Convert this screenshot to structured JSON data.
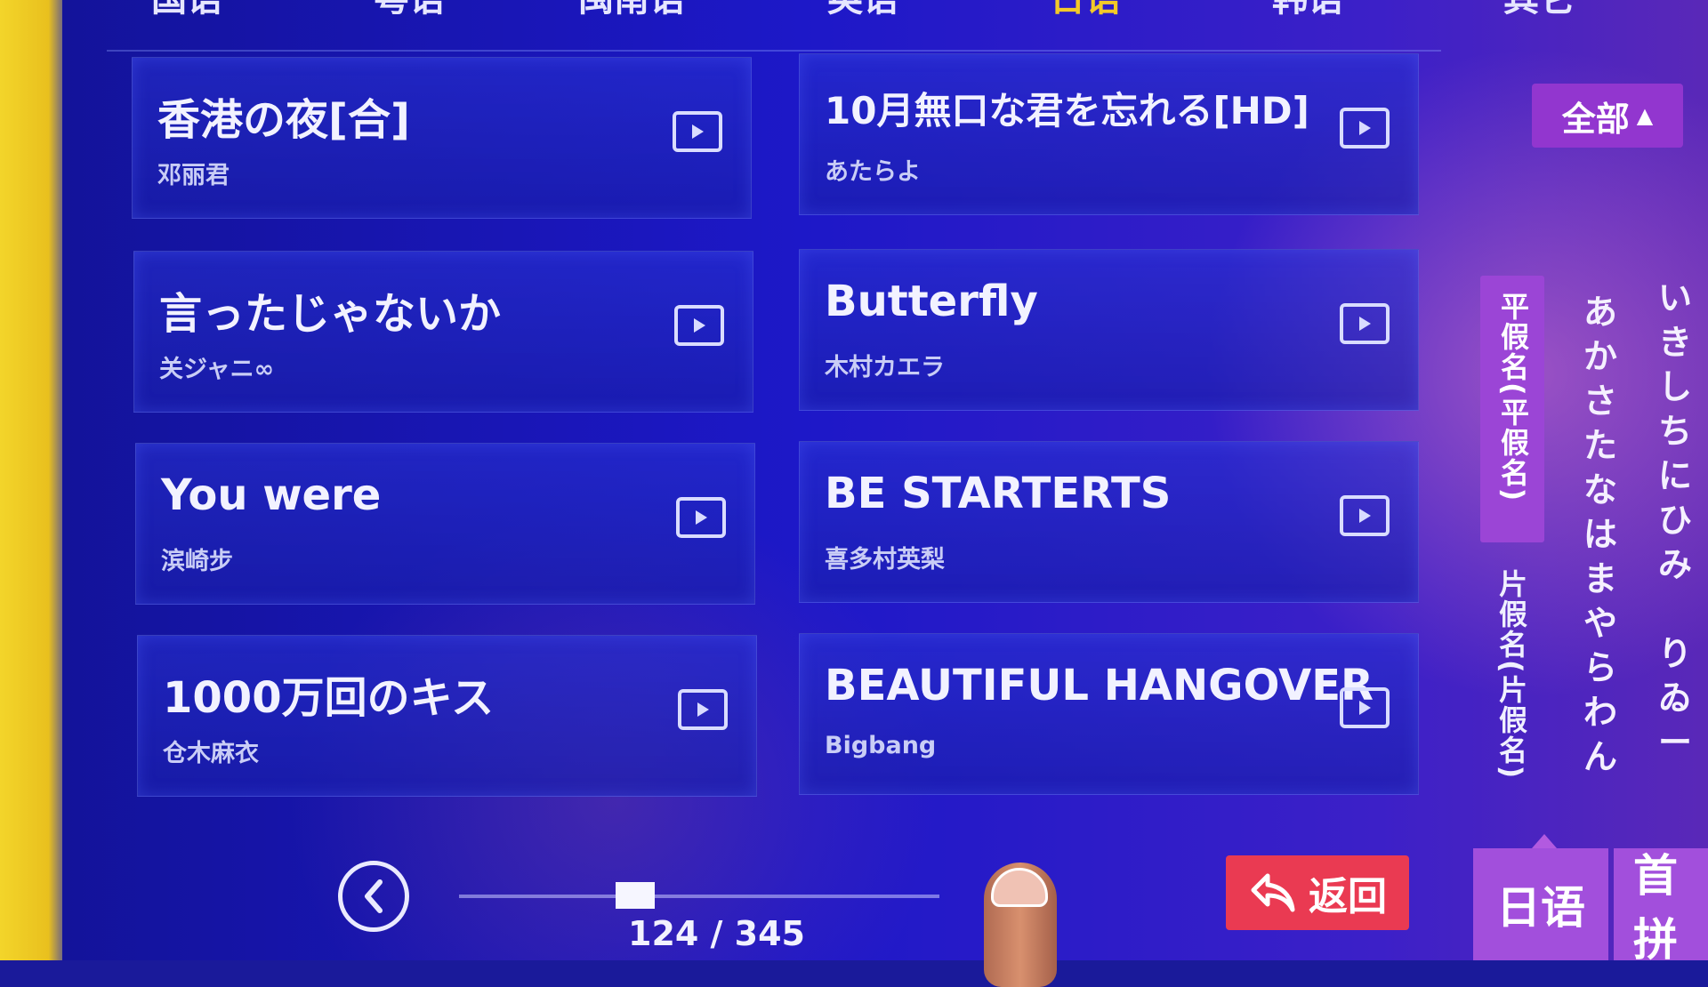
{
  "language_tabs": [
    {
      "label": "国语",
      "active": false
    },
    {
      "label": "粤语",
      "active": false
    },
    {
      "label": "闽南语",
      "active": false
    },
    {
      "label": "英语",
      "active": false
    },
    {
      "label": "日语",
      "active": true
    },
    {
      "label": "韩语",
      "active": false
    },
    {
      "label": "其它",
      "active": false
    }
  ],
  "songs": [
    {
      "title": "香港の夜[合]",
      "artist": "邓丽君"
    },
    {
      "title": "10月無口な君を忘れる[HD]",
      "artist": "あたらよ"
    },
    {
      "title": "言ったじゃないか",
      "artist": "关ジャニ∞"
    },
    {
      "title": "Butterfly",
      "artist": "木村カエラ"
    },
    {
      "title": "You were",
      "artist": "滨崎步"
    },
    {
      "title": "BE STARTERTS",
      "artist": "喜多村英梨"
    },
    {
      "title": "1000万回のキス",
      "artist": "仓木麻衣"
    },
    {
      "title": "BEAUTIFUL HANGOVER",
      "artist": "Bigbang"
    }
  ],
  "filter": {
    "label": "全部",
    "arrow": "▲"
  },
  "kana_panel": {
    "hiragana_label": "平假名(平假名)",
    "katakana_label": "片假名(片假名)",
    "column_a": [
      "あ",
      "か",
      "さ",
      "た",
      "な",
      "は",
      "ま",
      "や",
      "ら",
      "わ",
      "ん"
    ],
    "column_i": [
      "い",
      "き",
      "し",
      "ち",
      "に",
      "ひ",
      "み",
      "",
      "り",
      "ゐ",
      "ー"
    ]
  },
  "bottom_tabs": {
    "current": "日语",
    "next": "首拼"
  },
  "pager": {
    "current": 124,
    "total": 345,
    "text": "124 / 345"
  },
  "back_button": {
    "label": "返回"
  },
  "icons": {
    "play": "play-icon",
    "prev": "chevron-left-icon",
    "back": "back-arrow-icon"
  },
  "colors": {
    "accent_purple": "#9b45d6",
    "back_red": "#ea3a52",
    "active_tab": "#f3c928"
  }
}
